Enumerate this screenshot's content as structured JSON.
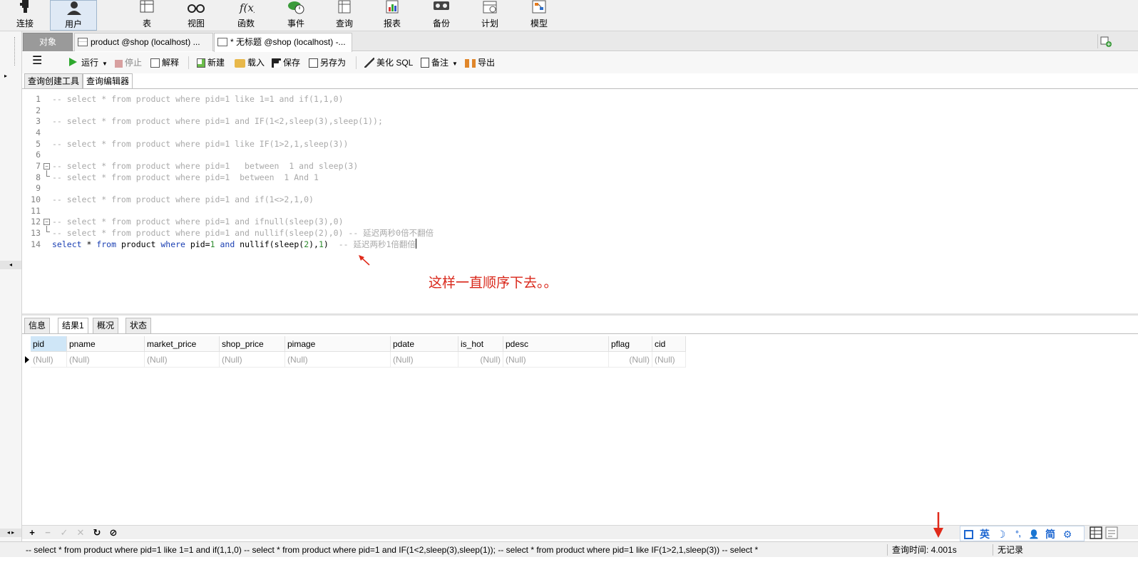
{
  "main_toolbar": {
    "buttons": [
      {
        "label": "连接",
        "icon": "plug-icon"
      },
      {
        "label": "用户",
        "icon": "user-icon",
        "active": true
      },
      {
        "label": "表",
        "icon": "table-icon"
      },
      {
        "label": "视图",
        "icon": "glasses-icon"
      },
      {
        "label": "函数",
        "icon": "function-icon"
      },
      {
        "label": "事件",
        "icon": "event-clock-icon"
      },
      {
        "label": "查询",
        "icon": "query-icon"
      },
      {
        "label": "报表",
        "icon": "report-chart-icon"
      },
      {
        "label": "备份",
        "icon": "backup-icon"
      },
      {
        "label": "计划",
        "icon": "schedule-icon"
      },
      {
        "label": "模型",
        "icon": "model-icon"
      }
    ]
  },
  "tabs": {
    "objects": "对象",
    "items": [
      {
        "label": "product @shop (localhost) ...",
        "icon": "table-icon"
      },
      {
        "label": "* 无标题 @shop (localhost) -...",
        "icon": "query-icon"
      }
    ]
  },
  "editor_toolbar": {
    "menu": "☰",
    "run": "运行",
    "stop": "停止",
    "explain": "解释",
    "new": "新建",
    "load": "载入",
    "save": "保存",
    "save_as": "另存为",
    "beautify": "美化 SQL",
    "comment": "备注",
    "export": "导出"
  },
  "sub_tabs": [
    "查询创建工具",
    "查询编辑器"
  ],
  "code_lines": [
    {
      "n": "1",
      "text": "-- select * from product where pid=1 like 1=1 and if(1,1,0)"
    },
    {
      "n": "2",
      "text": ""
    },
    {
      "n": "3",
      "text": "-- select * from product where pid=1 and IF(1<2,sleep(3),sleep(1));"
    },
    {
      "n": "4",
      "text": ""
    },
    {
      "n": "5",
      "text": "-- select * from product where pid=1 like IF(1>2,1,sleep(3))"
    },
    {
      "n": "6",
      "text": ""
    },
    {
      "n": "7",
      "text": "-- select * from product where pid=1   between  1 and sleep(3)"
    },
    {
      "n": "8",
      "text": "-- select * from product where pid=1  between  1 And 1"
    },
    {
      "n": "9",
      "text": ""
    },
    {
      "n": "10",
      "text": "-- select * from product where pid=1 and if(1<>2,1,0)"
    },
    {
      "n": "11",
      "text": ""
    },
    {
      "n": "12",
      "text": "-- select * from product where pid=1 and ifnull(sleep(3),0)"
    },
    {
      "n": "13",
      "text": "-- select * from product where pid=1 and nullif(sleep(2),0) -- 延迟两秒0倍不翻倍"
    },
    {
      "n": "14",
      "parts": {
        "kw_select": "select",
        "star": " * ",
        "kw_from": "from",
        "table": " product ",
        "kw_where": "where",
        "cond": " pid=",
        "one": "1",
        "sp": " ",
        "kw_and": "and",
        "fn": " nullif(sleep(",
        "two": "2",
        "mid": "),",
        "one2": "1",
        "close": ")",
        "comment": "  -- 延迟两秒1倍翻倍"
      }
    }
  ],
  "annotation": "这样一直顺序下去。。",
  "result_tabs": [
    "信息",
    "结果1",
    "概况",
    "状态"
  ],
  "grid": {
    "columns": [
      "pid",
      "pname",
      "market_price",
      "shop_price",
      "pimage",
      "pdate",
      "is_hot",
      "pdesc",
      "pflag",
      "cid"
    ],
    "rows": [
      [
        "(Null)",
        "(Null)",
        "(Null)",
        "(Null)",
        "(Null)",
        "(Null)",
        "(Null)",
        "(Null)",
        "(Null)",
        "(Null)"
      ]
    ]
  },
  "grid_toolbar": [
    "+",
    "−",
    "✓",
    "✕",
    "↻",
    "⊘"
  ],
  "status": {
    "sql_preview": "-- select * from product where pid=1 like 1=1 and if(1,1,0)  -- select * from product where pid=1 and IF(1<2,sleep(3),sleep(1));  -- select * from product where pid=1 like IF(1>2,1,sleep(3))  -- select *",
    "query_time": "查询时间: 4.001s",
    "records": "无记录"
  },
  "ime": {
    "lang": "英",
    "moon": "☽",
    "punct": "°,",
    "user": "👤",
    "simp": "简",
    "gear": "⚙"
  },
  "colors": {
    "annotation": "#d9271a",
    "keyword": "#1a3fb3",
    "number": "#2e8b2e",
    "comment": "#a9a9a9"
  }
}
